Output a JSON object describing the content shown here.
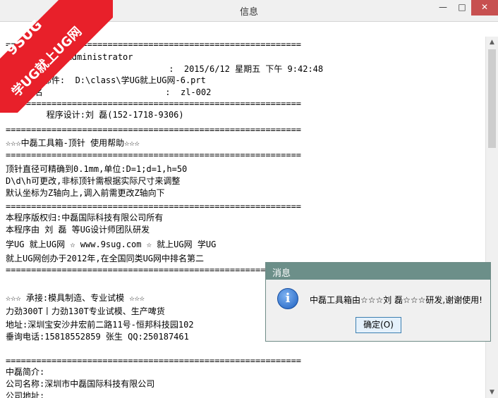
{
  "window": {
    "title": "信息",
    "minimize": "—",
    "maximize": "□",
    "close": "✕"
  },
  "banner": {
    "line1": "9SUG",
    "line2": "学UG就上UG网"
  },
  "content": {
    "lines": [
      "==========================================================",
      "    创建者:  Administrator",
      "                                :  2015/6/12 星期五 下午 9:42:48",
      "    工作部件:  D:\\class\\学UG就上UG网-6.prt",
      "    点名                        :  zl-002",
      "==========================================================",
      "        程序设计:刘 磊(152-1718-9306)",
      "==========================================================",
      "☆☆☆中磊工具箱-顶针 使用帮助☆☆☆",
      "==========================================================",
      "顶针直径可精确到0.1mm,单位:D=1;d=1,h=50",
      "D\\d\\h可更改,非标顶针需根据实际尺寸来调整",
      "默认坐标为Z轴向上,调入前需更改Z轴向下",
      "==========================================================",
      "本程序版权归:中磊国际科技有限公司所有",
      "本程序由 刘 磊 等UG设计师团队研发",
      "学UG 就上UG网 ☆ www.9sug.com ☆ 就上UG网 学UG",
      "就上UG网创办于2012年,在全国同类UG网中排名第二",
      "==========================================================",
      "☆☆☆ 承接:模具制造、专业试模 ☆☆☆",
      "力劲300T丨力劲130T专业试模、生产啤货",
      "地址:深圳宝安沙井宏前二路11号-恒邦科技园102",
      "垂询电话:15818552859 张生 QQ:250187461",
      "==========================================================",
      "中磊简介:",
      "公司名称:深圳市中磊国际科技有限公司",
      "公司地址:"
    ]
  },
  "dialog": {
    "title": "消息",
    "icon": "i",
    "message": "中磊工具箱由☆☆☆刘 磊☆☆☆研发,谢谢使用!",
    "ok_label": "确定(O)"
  },
  "scrollbar": {
    "up": "▲",
    "down": "▼"
  }
}
